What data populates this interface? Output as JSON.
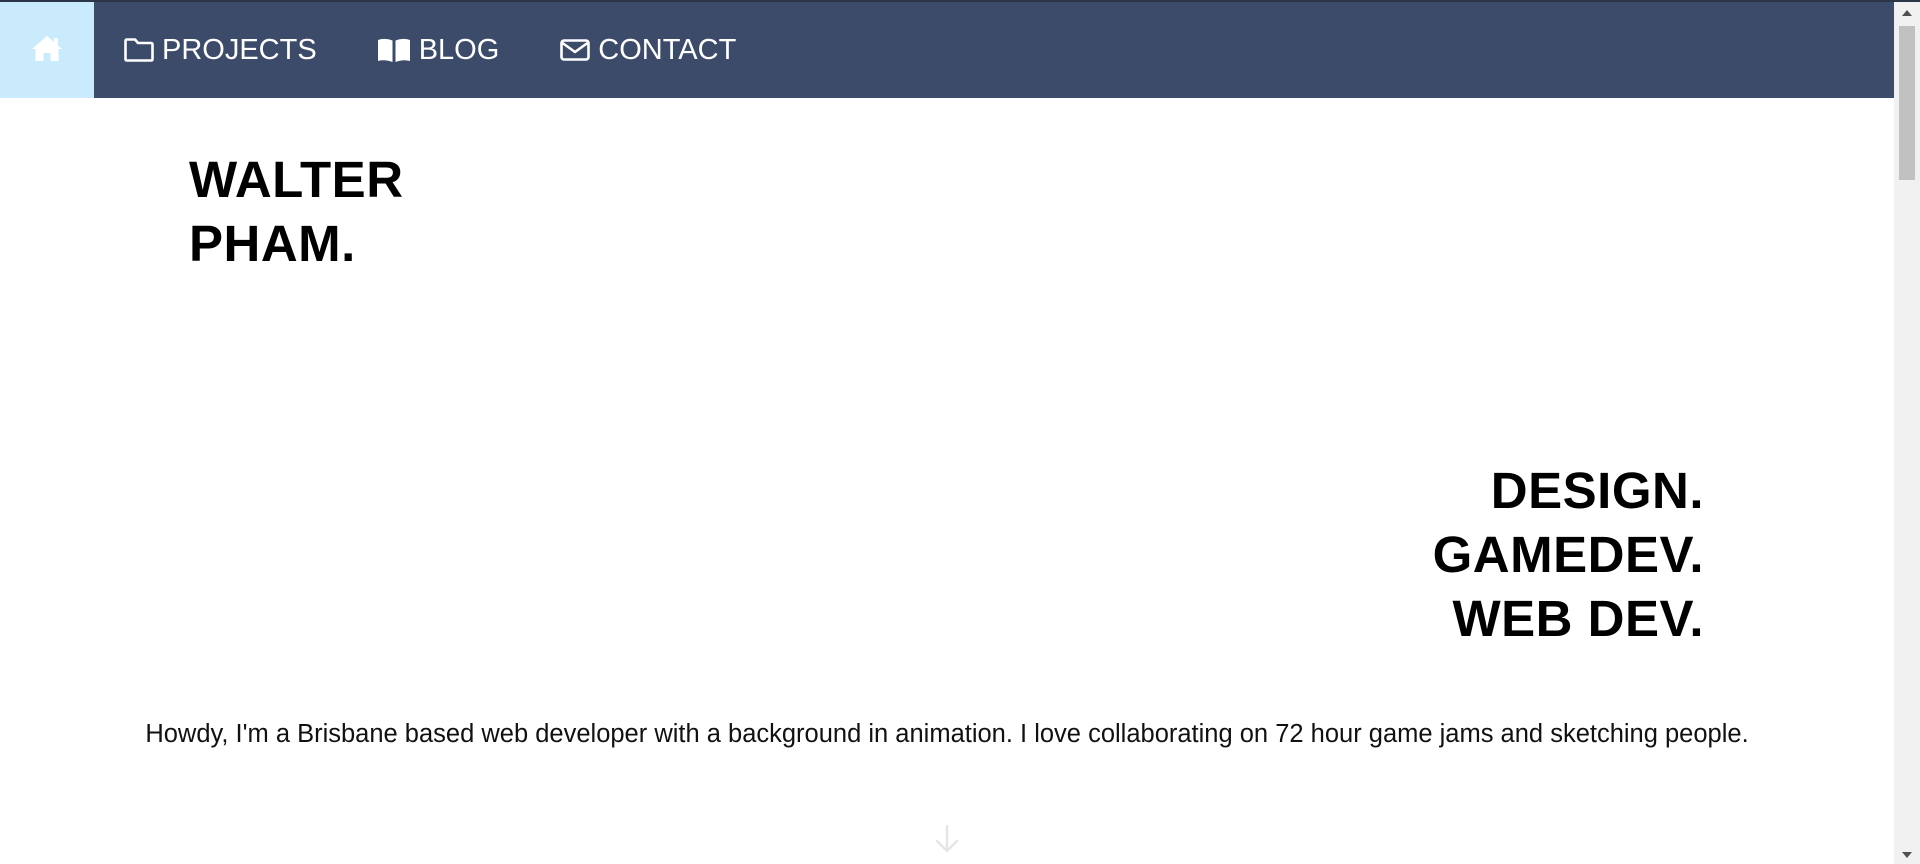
{
  "colors": {
    "nav_background": "#3d4b6b",
    "home_highlight": "#c9ebfb",
    "text": "#000000",
    "nav_text": "#ffffff"
  },
  "nav": {
    "home_icon": "home-icon",
    "items": [
      {
        "icon": "folder-icon",
        "label": "PROJECTS"
      },
      {
        "icon": "book-icon",
        "label": "BLOG"
      },
      {
        "icon": "envelope-icon",
        "label": "CONTACT"
      }
    ]
  },
  "hero": {
    "name_line1": "WALTER",
    "name_line2": "PHAM.",
    "skills": [
      "DESIGN.",
      "GAMEDEV.",
      "WEB DEV."
    ]
  },
  "intro": {
    "text": "Howdy, I'm a Brisbane based web developer with a background in animation. I love collaborating on 72 hour game jams and sketching people."
  },
  "scroll_hint": {
    "icon": "arrow-down-icon"
  }
}
